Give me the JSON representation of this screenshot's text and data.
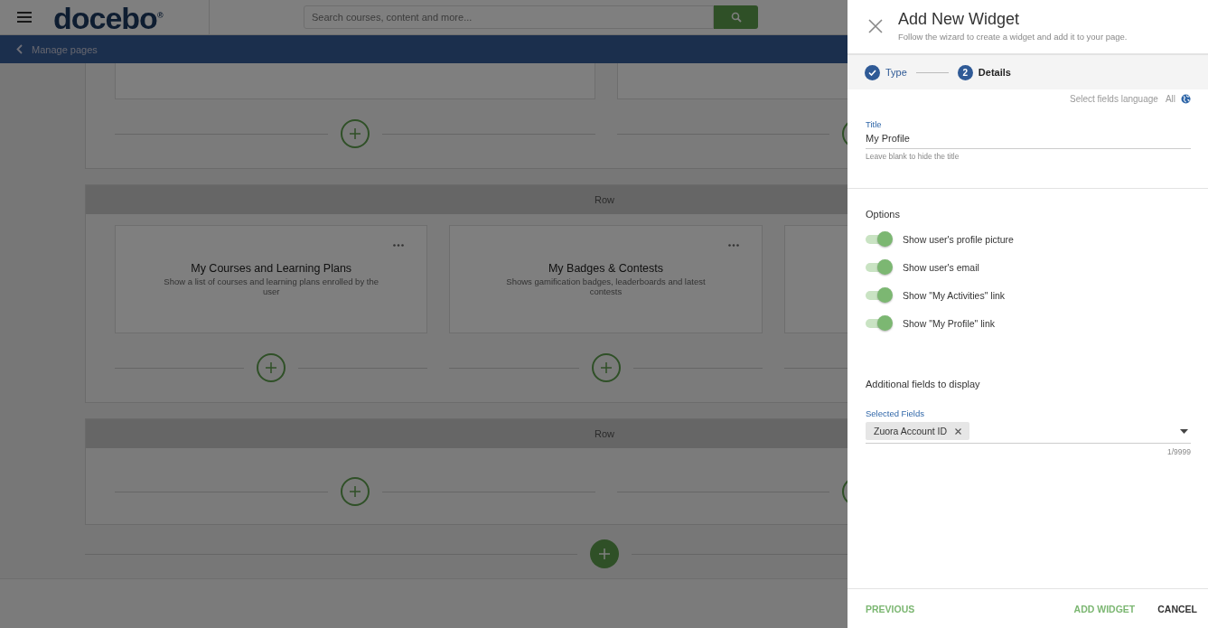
{
  "header": {
    "logo": "docebo$^{®}$",
    "search_placeholder": "Search courses, content and more..."
  },
  "breadcrumb": {
    "label": "Manage pages"
  },
  "rows": [
    {
      "columns": [
        {
          "kind": "empty"
        },
        {
          "kind": "empty"
        }
      ]
    },
    {
      "label": "Row",
      "columns": [
        {
          "kind": "widget",
          "title": "My Courses and Learning Plans",
          "description": "Show a list of courses and learning plans enrolled by the user"
        },
        {
          "kind": "widget",
          "title": "My Badges & Contests",
          "description": "Shows gamification badges, leaderboards and latest contests"
        },
        {
          "kind": "empty"
        }
      ]
    },
    {
      "label": "Row",
      "columns": [
        {
          "kind": "none"
        },
        {
          "kind": "none"
        }
      ]
    }
  ],
  "drawer": {
    "title": "Add New Widget",
    "subtitle": "Follow the wizard to create a widget and add it to your page.",
    "steps": [
      {
        "label": "Type",
        "completed": true,
        "selected": false
      },
      {
        "label": "Details",
        "number": "2",
        "completed": false,
        "selected": true
      }
    ],
    "language": {
      "label": "Select fields language",
      "value": "All"
    },
    "title_field": {
      "label": "Title",
      "value": "My Profile",
      "helper": "Leave blank to hide the title"
    },
    "options_heading": "Options",
    "options": [
      {
        "label": "Show user's profile picture",
        "on": true
      },
      {
        "label": "Show user's email",
        "on": true
      },
      {
        "label": "Show \"My Activities\" link",
        "on": true
      },
      {
        "label": "Show \"My Profile\" link",
        "on": true
      }
    ],
    "additional_heading": "Additional fields to display",
    "selected_fields": {
      "label": "Selected Fields",
      "chips": [
        "Zuora Account ID"
      ],
      "counter": "1/9999"
    },
    "buttons": {
      "previous": "PREVIOUS",
      "add": "ADD WIDGET",
      "cancel": "CANCEL"
    }
  }
}
